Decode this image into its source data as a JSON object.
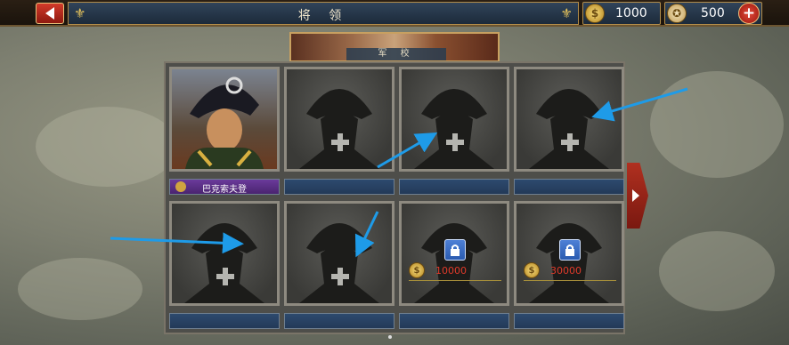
{
  "header": {
    "title": "将 领",
    "gold": "1000",
    "medals": "500",
    "plus_label": "+"
  },
  "banner": {
    "label": "军 校"
  },
  "slots": [
    {
      "type": "commander",
      "name": "巴克索夫登"
    },
    {
      "type": "empty"
    },
    {
      "type": "empty"
    },
    {
      "type": "empty"
    },
    {
      "type": "empty"
    },
    {
      "type": "empty"
    },
    {
      "type": "locked",
      "cost": "10000"
    },
    {
      "type": "locked",
      "cost": "30000"
    }
  ],
  "colors": {
    "arrow_annotation": "#1e9be8",
    "cost_text": "#e03a2a",
    "nameplate": "#2d4a6e",
    "commander_nameplate": "#6a3a9a"
  },
  "icons": [
    "back-arrow-icon",
    "fleur-de-lis-icon",
    "gold-coin-icon",
    "medal-icon",
    "plus-icon",
    "lock-icon",
    "next-arrow-icon"
  ]
}
